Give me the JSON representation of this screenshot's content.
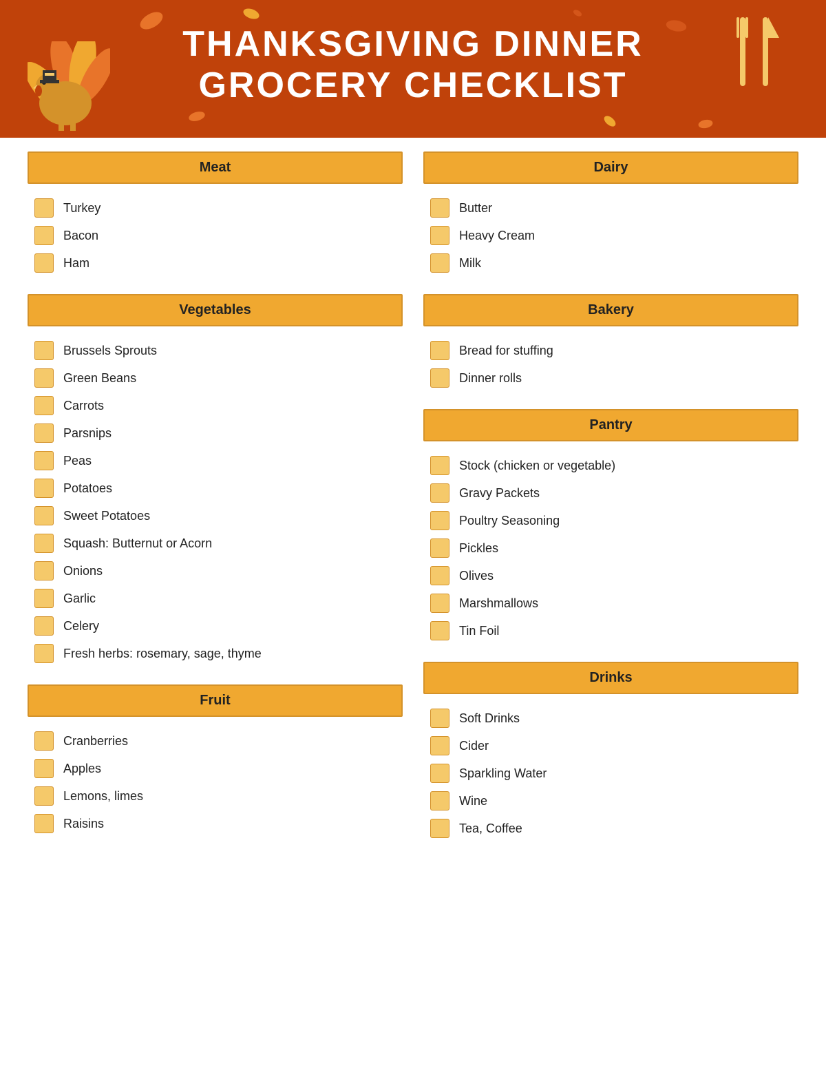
{
  "header": {
    "title_line1": "THANKSGIVING DINNER",
    "title_line2": "GROCERY CHECKLIST"
  },
  "sections": {
    "meat": {
      "label": "Meat",
      "items": [
        "Turkey",
        "Bacon",
        "Ham"
      ]
    },
    "dairy": {
      "label": "Dairy",
      "items": [
        "Butter",
        "Heavy Cream",
        "Milk"
      ]
    },
    "vegetables": {
      "label": "Vegetables",
      "items": [
        "Brussels Sprouts",
        "Green Beans",
        "Carrots",
        "Parsnips",
        "Peas",
        "Potatoes",
        "Sweet Potatoes",
        "Squash: Butternut or Acorn",
        "Onions",
        "Garlic",
        "Celery",
        "Fresh herbs: rosemary, sage, thyme"
      ]
    },
    "bakery": {
      "label": "Bakery",
      "items": [
        "Bread for stuffing",
        "Dinner rolls"
      ]
    },
    "pantry": {
      "label": "Pantry",
      "items": [
        "Stock (chicken or vegetable)",
        "Gravy Packets",
        "Poultry Seasoning",
        "Pickles",
        "Olives",
        "Marshmallows",
        "Tin Foil"
      ]
    },
    "fruit": {
      "label": "Fruit",
      "items": [
        "Cranberries",
        "Apples",
        "Lemons, limes",
        "Raisins"
      ]
    },
    "drinks": {
      "label": "Drinks",
      "items": [
        "Soft Drinks",
        "Cider",
        "Sparkling Water",
        "Wine",
        "Tea, Coffee"
      ]
    }
  }
}
